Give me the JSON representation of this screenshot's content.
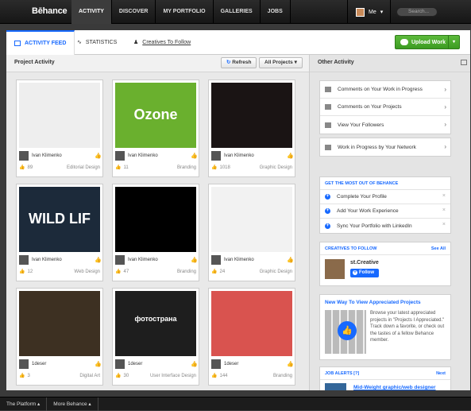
{
  "brand": "Bēhance",
  "nav": [
    "ACTIVITY",
    "DISCOVER",
    "MY PORTFOLIO",
    "GALLERIES",
    "JOBS"
  ],
  "user": {
    "name": "Me"
  },
  "search": {
    "placeholder": "Search..."
  },
  "tabs": [
    {
      "label": "ACTIVITY FEED",
      "icon": "feed-icon"
    },
    {
      "label": "STATISTICS",
      "icon": "statistics-icon"
    },
    {
      "label": "Creatives To Follow",
      "icon": "creatives-icon"
    }
  ],
  "upload_label": "Upload Work",
  "project_activity": {
    "title": "Project Activity",
    "refresh_label": "Refresh",
    "filter_label": "All Projects",
    "projects": [
      {
        "owner": "Ivan Klimenko",
        "appreciations": "89",
        "field": "Editorial Design",
        "thumb": "editorial",
        "thumb_color": "#eeeeee"
      },
      {
        "owner": "Ivan Klimenko",
        "appreciations": "11",
        "field": "Branding",
        "thumb": "ozone",
        "thumb_color": "#6ab02e",
        "thumb_text": "Ozone"
      },
      {
        "owner": "Ivan Klimenko",
        "appreciations": "1018",
        "field": "Graphic Design",
        "thumb": "disc",
        "thumb_color": "#1a1414"
      },
      {
        "owner": "Ivan Klimenko",
        "appreciations": "12",
        "field": "Web Design",
        "thumb": "web",
        "thumb_color": "#1c2a3a",
        "thumb_text": "WILD LIF"
      },
      {
        "owner": "Ivan Klimenko",
        "appreciations": "47",
        "field": "Branding",
        "thumb": "logo-m",
        "thumb_color": "#000000"
      },
      {
        "owner": "Ivan Klimenko",
        "appreciations": "24",
        "field": "Graphic Design",
        "thumb": "icons",
        "thumb_color": "#f2f2f2"
      },
      {
        "owner": "1deser",
        "appreciations": "3",
        "field": "Digital Art",
        "thumb": "house",
        "thumb_color": "#3d3022"
      },
      {
        "owner": "1deser",
        "appreciations": "30",
        "field": "User Interface Design",
        "thumb": "fotostrana",
        "thumb_color": "#1e1e1e",
        "thumb_text": "фотострана"
      },
      {
        "owner": "1deser",
        "appreciations": "144",
        "field": "Branding",
        "thumb": "chat",
        "thumb_color": "#d9534f"
      }
    ]
  },
  "other_activity": {
    "title": "Other Activity",
    "links": [
      {
        "label": "Comments on Your Work in Progress",
        "icon": "wip-comments-icon"
      },
      {
        "label": "Comments on Your Projects",
        "icon": "comments-icon"
      },
      {
        "label": "View Your Followers",
        "icon": "followers-icon"
      }
    ],
    "network_link": {
      "label": "Work in Progress by Your Network",
      "icon": "network-icon"
    },
    "get_most": {
      "title": "GET THE MOST OUT OF BEHANCE",
      "items": [
        "Complete Your Profile",
        "Add Your Work Experience",
        "Sync Your Portfolio with LinkedIn"
      ]
    },
    "creatives": {
      "title": "CREATIVES TO FOLLOW",
      "see_all": "See All",
      "name": "st.Creative",
      "follow_label": "Follow"
    },
    "appreciated": {
      "title": "New Way To View Appreciated Projects",
      "text": "Browse your latest appreciated projects in \"Projects I Appreciated.\" Track down a favorite, or check out the tastes of a fellow Behance member."
    },
    "job_alerts": {
      "title": "JOB ALERTS [?]",
      "next": "Next",
      "first_job": "Mid-Weight graphic/web designer"
    }
  },
  "footer": [
    "The Platform",
    "More Behance"
  ],
  "colors": {
    "accent": "#1769ff",
    "upload": "#4aa82c"
  }
}
